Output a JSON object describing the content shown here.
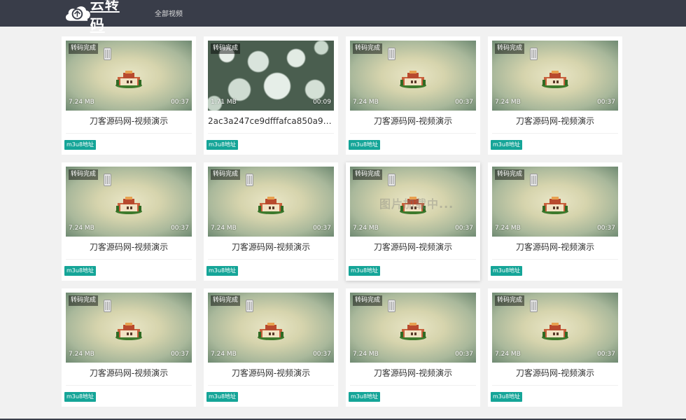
{
  "header": {
    "brand": "云转码",
    "nav": "全部视频"
  },
  "loading_text": "图片加载中...",
  "colors": {
    "header_bg": "#393d49",
    "tag_bg": "#15a598",
    "page_bg": "#f1f1f1"
  },
  "videos": [
    {
      "status": "转码完成",
      "size": "7.24 MB",
      "duration": "00:37",
      "title": "刀客源码网-视频演示",
      "tag": "m3u8地址",
      "thumb": "building"
    },
    {
      "status": "转码完成",
      "size": "1.71 MB",
      "duration": "00:09",
      "title": "2ac3a247ce9dfffafca850a9aa...",
      "tag": "m3u8地址",
      "thumb": "flowers"
    },
    {
      "status": "转码完成",
      "size": "7.24 MB",
      "duration": "00:37",
      "title": "刀客源码网-视频演示",
      "tag": "m3u8地址",
      "thumb": "building"
    },
    {
      "status": "转码完成",
      "size": "7.24 MB",
      "duration": "00:37",
      "title": "刀客源码网-视频演示",
      "tag": "m3u8地址",
      "thumb": "building"
    },
    {
      "status": "转码完成",
      "size": "7.24 MB",
      "duration": "00:37",
      "title": "刀客源码网-视频演示",
      "tag": "m3u8地址",
      "thumb": "building"
    },
    {
      "status": "转码完成",
      "size": "7.24 MB",
      "duration": "00:37",
      "title": "刀客源码网-视频演示",
      "tag": "m3u8地址",
      "thumb": "building"
    },
    {
      "status": "转码完成",
      "size": "7.24 MB",
      "duration": "00:37",
      "title": "刀客源码网-视频演示",
      "tag": "m3u8地址",
      "thumb": "building"
    },
    {
      "status": "转码完成",
      "size": "7.24 MB",
      "duration": "00:37",
      "title": "刀客源码网-视频演示",
      "tag": "m3u8地址",
      "thumb": "building"
    },
    {
      "status": "转码完成",
      "size": "7.24 MB",
      "duration": "00:37",
      "title": "刀客源码网-视频演示",
      "tag": "m3u8地址",
      "thumb": "building"
    },
    {
      "status": "转码完成",
      "size": "7.24 MB",
      "duration": "00:37",
      "title": "刀客源码网-视频演示",
      "tag": "m3u8地址",
      "thumb": "building"
    },
    {
      "status": "转码完成",
      "size": "7.24 MB",
      "duration": "00:37",
      "title": "刀客源码网-视频演示",
      "tag": "m3u8地址",
      "thumb": "building"
    },
    {
      "status": "转码完成",
      "size": "7.24 MB",
      "duration": "00:37",
      "title": "刀客源码网-视频演示",
      "tag": "m3u8地址",
      "thumb": "building"
    }
  ]
}
